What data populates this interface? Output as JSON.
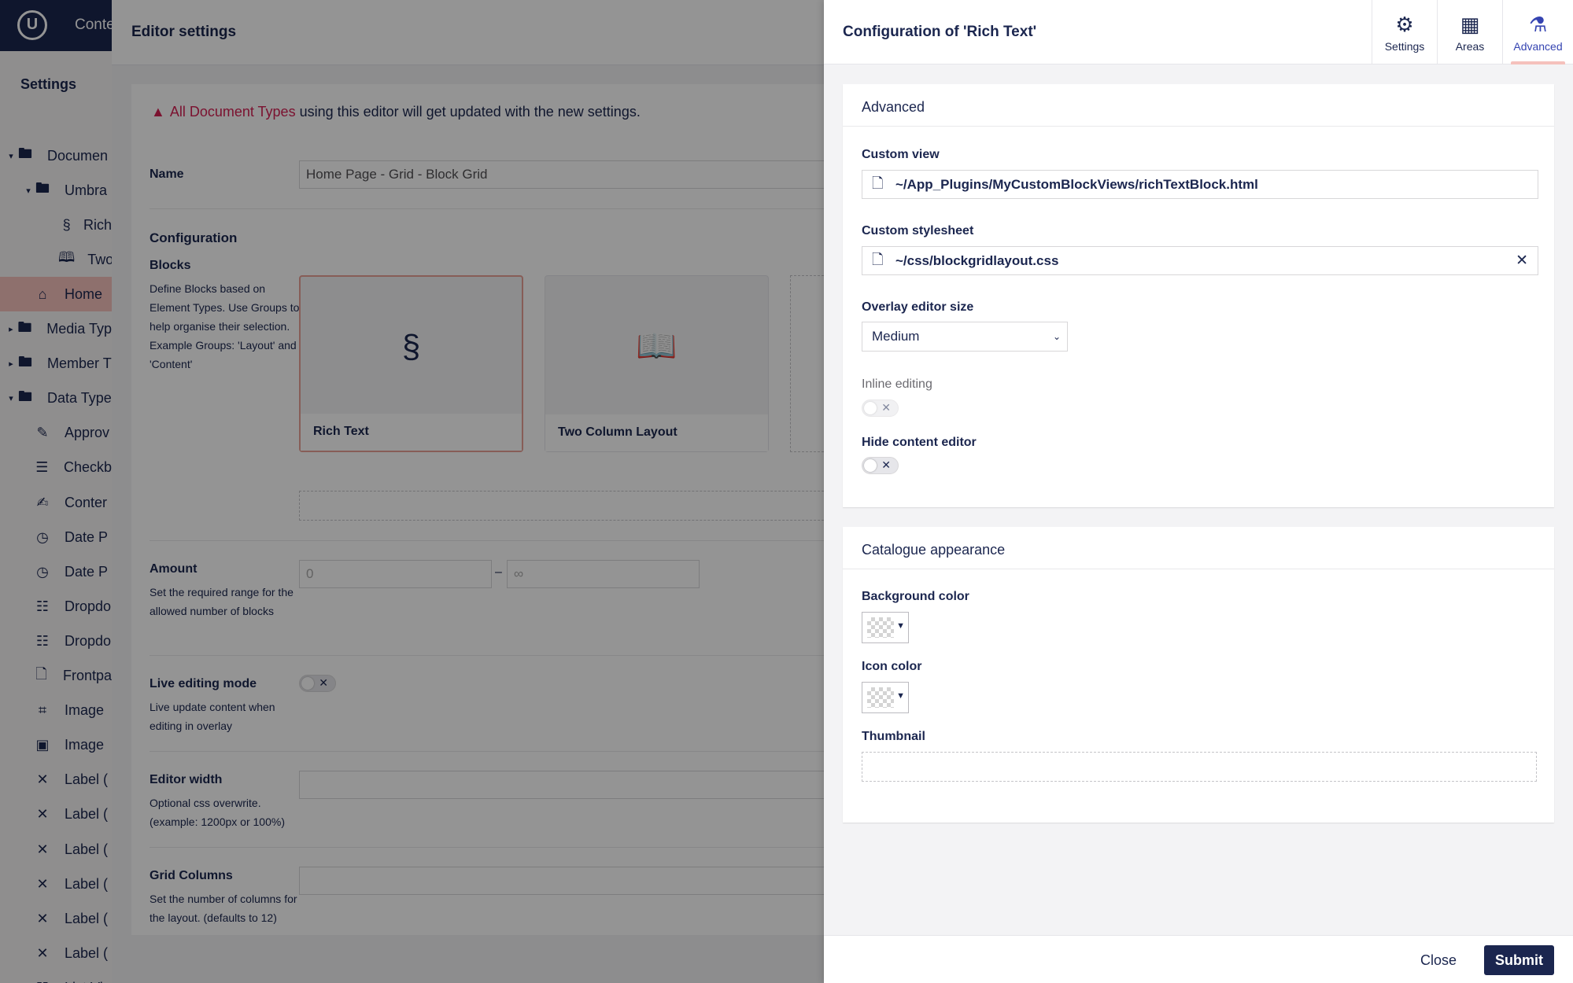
{
  "app": {
    "topbar_label": "Conte",
    "logo": "U",
    "sidebar": {
      "title": "Settings",
      "items": [
        {
          "label": "Documen",
          "icon": "folder-icon",
          "caret": "▾",
          "indent": 0
        },
        {
          "label": "Umbra",
          "icon": "folder-icon",
          "caret": "▾",
          "indent": 1
        },
        {
          "label": "Rich",
          "icon": "rich-text-icon",
          "caret": "",
          "indent": 2
        },
        {
          "label": "Two",
          "icon": "book-icon",
          "caret": "",
          "indent": 2
        },
        {
          "label": "Home",
          "icon": "home-icon",
          "caret": "",
          "indent": 1,
          "active": true
        },
        {
          "label": "Media Typ",
          "icon": "folder-icon",
          "caret": "▸",
          "indent": 0
        },
        {
          "label": "Member T",
          "icon": "folder-icon",
          "caret": "▸",
          "indent": 0
        },
        {
          "label": "Data Type",
          "icon": "folder-icon",
          "caret": "▾",
          "indent": 0
        },
        {
          "label": "Approv",
          "icon": "eyedropper-icon",
          "caret": "",
          "indent": 1
        },
        {
          "label": "Checkb",
          "icon": "list-icon",
          "caret": "",
          "indent": 1
        },
        {
          "label": "Conter",
          "icon": "edit-icon",
          "caret": "",
          "indent": 1
        },
        {
          "label": "Date P",
          "icon": "clock-icon",
          "caret": "",
          "indent": 1
        },
        {
          "label": "Date P",
          "icon": "clock-icon",
          "caret": "",
          "indent": 1
        },
        {
          "label": "Dropdo",
          "icon": "dropdown-list-icon",
          "caret": "",
          "indent": 1
        },
        {
          "label": "Dropdo",
          "icon": "dropdown-list-icon",
          "caret": "",
          "indent": 1
        },
        {
          "label": "Frontpa",
          "icon": "document-icon",
          "caret": "",
          "indent": 1
        },
        {
          "label": "Image",
          "icon": "crop-icon",
          "caret": "",
          "indent": 1
        },
        {
          "label": "Image",
          "icon": "picture-icon",
          "caret": "",
          "indent": 1
        },
        {
          "label": "Label (",
          "icon": "label-icon",
          "caret": "",
          "indent": 1
        },
        {
          "label": "Label (",
          "icon": "label-icon",
          "caret": "",
          "indent": 1
        },
        {
          "label": "Label (",
          "icon": "label-icon",
          "caret": "",
          "indent": 1
        },
        {
          "label": "Label (",
          "icon": "label-icon",
          "caret": "",
          "indent": 1
        },
        {
          "label": "Label (",
          "icon": "label-icon",
          "caret": "",
          "indent": 1
        },
        {
          "label": "Label (",
          "icon": "label-icon",
          "caret": "",
          "indent": 1
        },
        {
          "label": "List Vie",
          "icon": "grid-list-icon",
          "caret": "",
          "indent": 1
        }
      ]
    }
  },
  "editor": {
    "title": "Editor settings",
    "notice": {
      "warning_icon": "▲",
      "doc_types": "All Document Types",
      "text": " using this editor will get updated with the new settings."
    },
    "name_label": "Name",
    "name_value": "Home Page - Grid - Block Grid",
    "configuration_heading": "Configuration",
    "blocks_label": "Blocks",
    "blocks_desc": "Define Blocks based on Element Types. Use Groups to help organise their selection. Example Groups: 'Layout' and 'Content'",
    "blocks": [
      {
        "label": "Rich Text",
        "icon": "rich-text-icon",
        "glyph": "§"
      },
      {
        "label": "Two Column Layout",
        "icon": "book-icon",
        "glyph": "📖"
      }
    ],
    "amount_label": "Amount",
    "amount_desc": "Set the required range for the allowed number of blocks",
    "amount_min_placeholder": "0",
    "amount_sep": "–",
    "amount_max_placeholder": "∞",
    "live_label": "Live editing mode",
    "live_desc": "Live update content when editing in overlay",
    "width_label": "Editor width",
    "width_desc": "Optional css overwrite. (example: 1200px or 100%)",
    "grid_label": "Grid Columns",
    "grid_desc": "Set the number of columns for the layout. (defaults to 12)"
  },
  "config": {
    "title": "Configuration of 'Rich Text'",
    "tabs": [
      {
        "label": "Settings",
        "icon": "gear-icon",
        "glyph": "⚙"
      },
      {
        "label": "Areas",
        "icon": "layout-icon",
        "glyph": "▦"
      },
      {
        "label": "Advanced",
        "icon": "flask-icon",
        "glyph": "⚗",
        "active": true
      }
    ],
    "advanced": {
      "heading": "Advanced",
      "custom_view_label": "Custom view",
      "custom_view_value": "~/App_Plugins/MyCustomBlockViews/richTextBlock.html",
      "custom_stylesheet_label": "Custom stylesheet",
      "custom_stylesheet_value": "~/css/blockgridlayout.css",
      "clear_glyph": "✕",
      "overlay_size_label": "Overlay editor size",
      "overlay_size_value": "Medium",
      "inline_editing_label": "Inline editing",
      "hide_content_label": "Hide content editor"
    },
    "catalogue": {
      "heading": "Catalogue appearance",
      "background_color_label": "Background color",
      "icon_color_label": "Icon color",
      "thumbnail_label": "Thumbnail"
    },
    "footer": {
      "close_label": "Close",
      "submit_label": "Submit"
    }
  }
}
